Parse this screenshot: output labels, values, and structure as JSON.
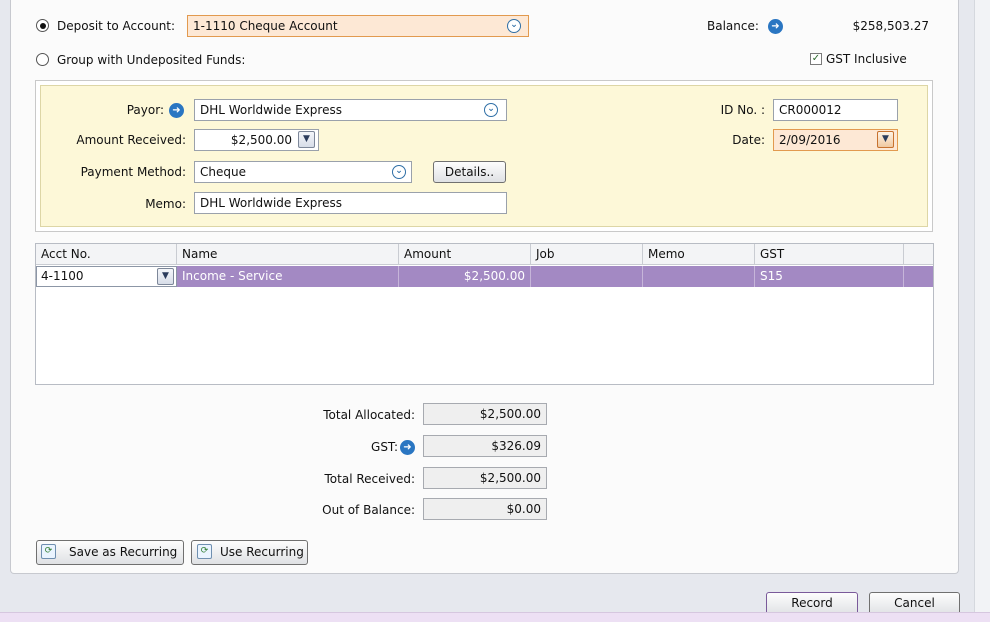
{
  "deposit": {
    "deposit_label": "Deposit to Account:",
    "account_value": "1-1110 Cheque Account",
    "group_label": "Group with Undeposited Funds:",
    "balance_label": "Balance:",
    "balance_value": "$258,503.27",
    "gst_inclusive_label": "GST Inclusive",
    "gst_inclusive_checked": true
  },
  "payor": {
    "payor_label": "Payor:",
    "payor_value": "DHL Worldwide Express",
    "amount_label": "Amount Received:",
    "amount_value": "$2,500.00",
    "method_label": "Payment Method:",
    "method_value": "Cheque",
    "details_label": "Details..",
    "memo_label": "Memo:",
    "memo_value": "DHL Worldwide Express",
    "id_label": "ID No. :",
    "id_value": "CR000012",
    "date_label": "Date:",
    "date_value": "2/09/2016"
  },
  "grid": {
    "columns": [
      "Acct No.",
      "Name",
      "Amount",
      "Job",
      "Memo",
      "GST"
    ],
    "rows": [
      {
        "acct": "4-1100",
        "name": "Income - Service",
        "amount": "$2,500.00",
        "job": "",
        "memo": "",
        "gst": "S15"
      }
    ]
  },
  "totals": {
    "allocated_label": "Total Allocated:",
    "allocated_value": "$2,500.00",
    "gst_label": "GST:",
    "gst_value": "$326.09",
    "received_label": "Total Received:",
    "received_value": "$2,500.00",
    "out_label": "Out of Balance:",
    "out_value": "$0.00"
  },
  "actions": {
    "save_recurring": "Save as Recurring",
    "use_recurring": "Use Recurring",
    "record": "Record",
    "cancel": "Cancel"
  },
  "icons": {
    "combo": "chevron-circle-down-icon",
    "arrow": "arrow-right-circle-icon",
    "dropdown": "chevron-down-icon"
  },
  "colors": {
    "accent_field": "#fde8d5",
    "payor_panel": "#fdf8d8",
    "selected_row": "#a389c3",
    "link_blue": "#2a76c2"
  }
}
